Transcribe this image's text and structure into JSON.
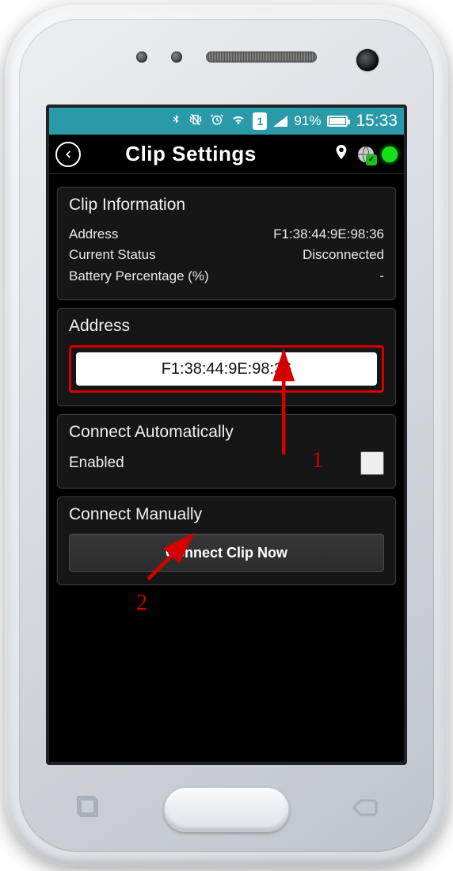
{
  "status_bar": {
    "battery_percent_text": "91%",
    "time": "15:33",
    "sim_slot": "1"
  },
  "app_bar": {
    "title": "Clip Settings"
  },
  "clip_info": {
    "card_title": "Clip Information",
    "rows": [
      {
        "label": "Address",
        "value": "F1:38:44:9E:98:36"
      },
      {
        "label": "Current Status",
        "value": "Disconnected"
      },
      {
        "label": "Battery Percentage (%)",
        "value": "-"
      }
    ]
  },
  "address_card": {
    "title": "Address",
    "value": "F1:38:44:9E:98:36"
  },
  "auto_connect": {
    "title": "Connect Automatically",
    "enabled_label": "Enabled",
    "checked": false
  },
  "manual_connect": {
    "title": "Connect Manually",
    "button_label": "Connect Clip Now"
  },
  "annotations": {
    "num1": "1",
    "num2": "2"
  }
}
